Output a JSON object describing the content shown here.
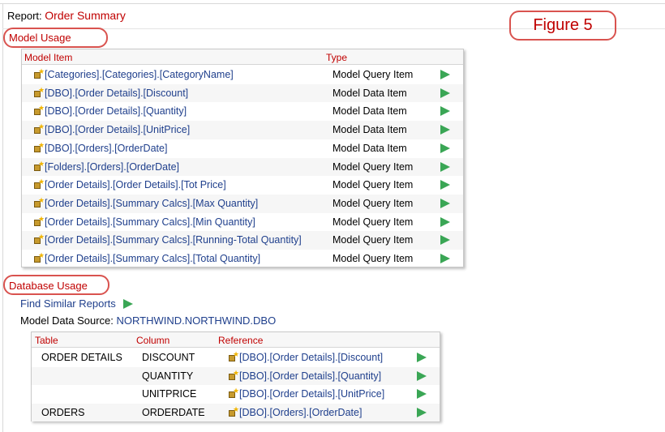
{
  "report": {
    "label": "Report:",
    "name": "Order Summary"
  },
  "figure_label": "Figure 5",
  "model_usage": {
    "title": "Model Usage",
    "headers": {
      "item": "Model Item",
      "type": "Type"
    },
    "rows": [
      {
        "item": "[Categories].[Categories].[CategoryName]",
        "type": "Model Query Item"
      },
      {
        "item": "[DBO].[Order Details].[Discount]",
        "type": "Model Data Item"
      },
      {
        "item": "[DBO].[Order Details].[Quantity]",
        "type": "Model Data Item"
      },
      {
        "item": "[DBO].[Order Details].[UnitPrice]",
        "type": "Model Data Item"
      },
      {
        "item": "[DBO].[Orders].[OrderDate]",
        "type": "Model Data Item"
      },
      {
        "item": "[Folders].[Orders].[OrderDate]",
        "type": "Model Query Item"
      },
      {
        "item": "[Order Details].[Order Details].[Tot Price]",
        "type": "Model Query Item"
      },
      {
        "item": "[Order Details].[Summary Calcs].[Max Quantity]",
        "type": "Model Query Item"
      },
      {
        "item": "[Order Details].[Summary Calcs].[Min Quantity]",
        "type": "Model Query Item"
      },
      {
        "item": "[Order Details].[Summary Calcs].[Running-Total Quantity]",
        "type": "Model Query Item"
      },
      {
        "item": "[Order Details].[Summary Calcs].[Total Quantity]",
        "type": "Model Query Item"
      }
    ]
  },
  "database_usage": {
    "title": "Database Usage",
    "find_similar": "Find Similar Reports",
    "source_label": "Model Data Source:",
    "source_value": "NORTHWIND.NORTHWIND.DBO",
    "headers": {
      "table": "Table",
      "column": "Column",
      "reference": "Reference"
    },
    "rows": [
      {
        "table": "ORDER DETAILS",
        "column": "DISCOUNT",
        "reference": "[DBO].[Order Details].[Discount]"
      },
      {
        "table": "",
        "column": "QUANTITY",
        "reference": "[DBO].[Order Details].[Quantity]"
      },
      {
        "table": "",
        "column": "UNITPRICE",
        "reference": "[DBO].[Order Details].[UnitPrice]"
      },
      {
        "table": "ORDERS",
        "column": "ORDERDATE",
        "reference": "[DBO].[Orders].[OrderDate]"
      }
    ]
  },
  "colors": {
    "accent_red": "#c00000",
    "link_blue": "#1f3f8c",
    "run_green": "#3aa655",
    "oval": "#d9534f"
  },
  "icons": {
    "model_item": "model-item-icon",
    "run": "run-arrow-icon"
  }
}
